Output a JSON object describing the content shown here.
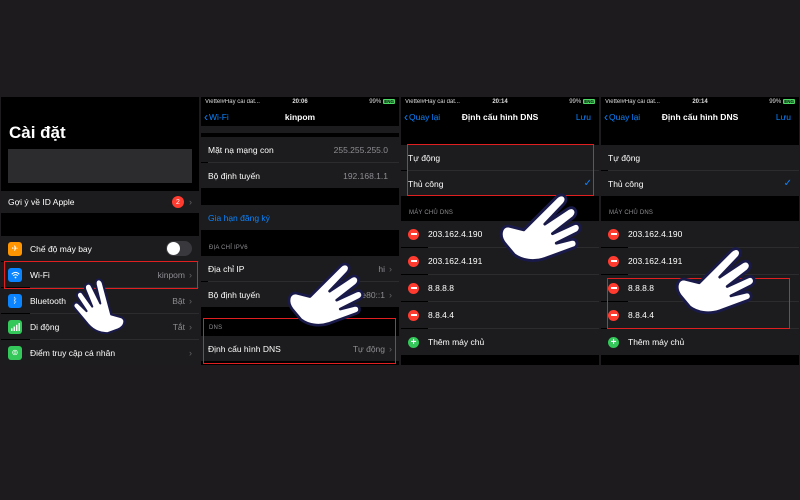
{
  "status": {
    "carrier": "Viettel#Hay cai dat...",
    "battery": "99%",
    "battery_tag": "ENG"
  },
  "panel1": {
    "title": "Cài đặt",
    "apple_id": {
      "label": "Gợi ý về ID Apple",
      "badge": "2"
    },
    "rows": [
      {
        "label": "Chế độ máy bay",
        "value": "",
        "icon": "airplane-icon",
        "color": "#ff9500"
      },
      {
        "label": "Wi-Fi",
        "value": "kinpom",
        "icon": "wifi-icon",
        "color": "#0a84ff"
      },
      {
        "label": "Bluetooth",
        "value": "Bật",
        "icon": "bluetooth-icon",
        "color": "#0a84ff"
      },
      {
        "label": "Di động",
        "value": "Tắt",
        "icon": "cellular-icon",
        "color": "#34c759"
      },
      {
        "label": "Điểm truy cập cá nhân",
        "value": "",
        "icon": "hotspot-icon",
        "color": "#34c759"
      }
    ]
  },
  "panel2": {
    "time": "20:06",
    "back": "Wi-Fi",
    "title": "kinpom",
    "rows": [
      {
        "label": "Mặt nạ mạng con",
        "value": "255.255.255.0"
      },
      {
        "label": "Bộ định tuyến",
        "value": "192.168.1.1"
      }
    ],
    "lease": "Gia hạn đăng ký",
    "ipv6_header": "ĐỊA CHỈ IPV6",
    "ipv6_rows": [
      {
        "label": "Địa chỉ IP",
        "value": "hi"
      },
      {
        "label": "Bộ định tuyến",
        "value": "fe80::1"
      }
    ],
    "dns_header": "DNS",
    "dns_row": {
      "label": "Định cấu hình DNS",
      "value": "Tự động"
    }
  },
  "panel3": {
    "time": "20:14",
    "back": "Quay lại",
    "title": "Định cấu hình DNS",
    "save": "Lưu",
    "options": [
      "Tự động",
      "Thủ công"
    ],
    "servers_header": "MÁY CHỦ DNS",
    "servers": [
      "203.162.4.190",
      "203.162.4.191",
      "8.8.8.8",
      "8.8.4.4"
    ],
    "add": "Thêm máy chủ"
  },
  "panel4": {
    "time": "20:14",
    "back": "Quay lại",
    "title": "Định cấu hình DNS",
    "save": "Lưu",
    "options": [
      "Tự động",
      "Thủ công"
    ],
    "servers_header": "MÁY CHỦ DNS",
    "servers": [
      "203.162.4.190",
      "203.162.4.191",
      "8.8.8.8",
      "8.8.4.4"
    ],
    "add": "Thêm máy chủ"
  }
}
